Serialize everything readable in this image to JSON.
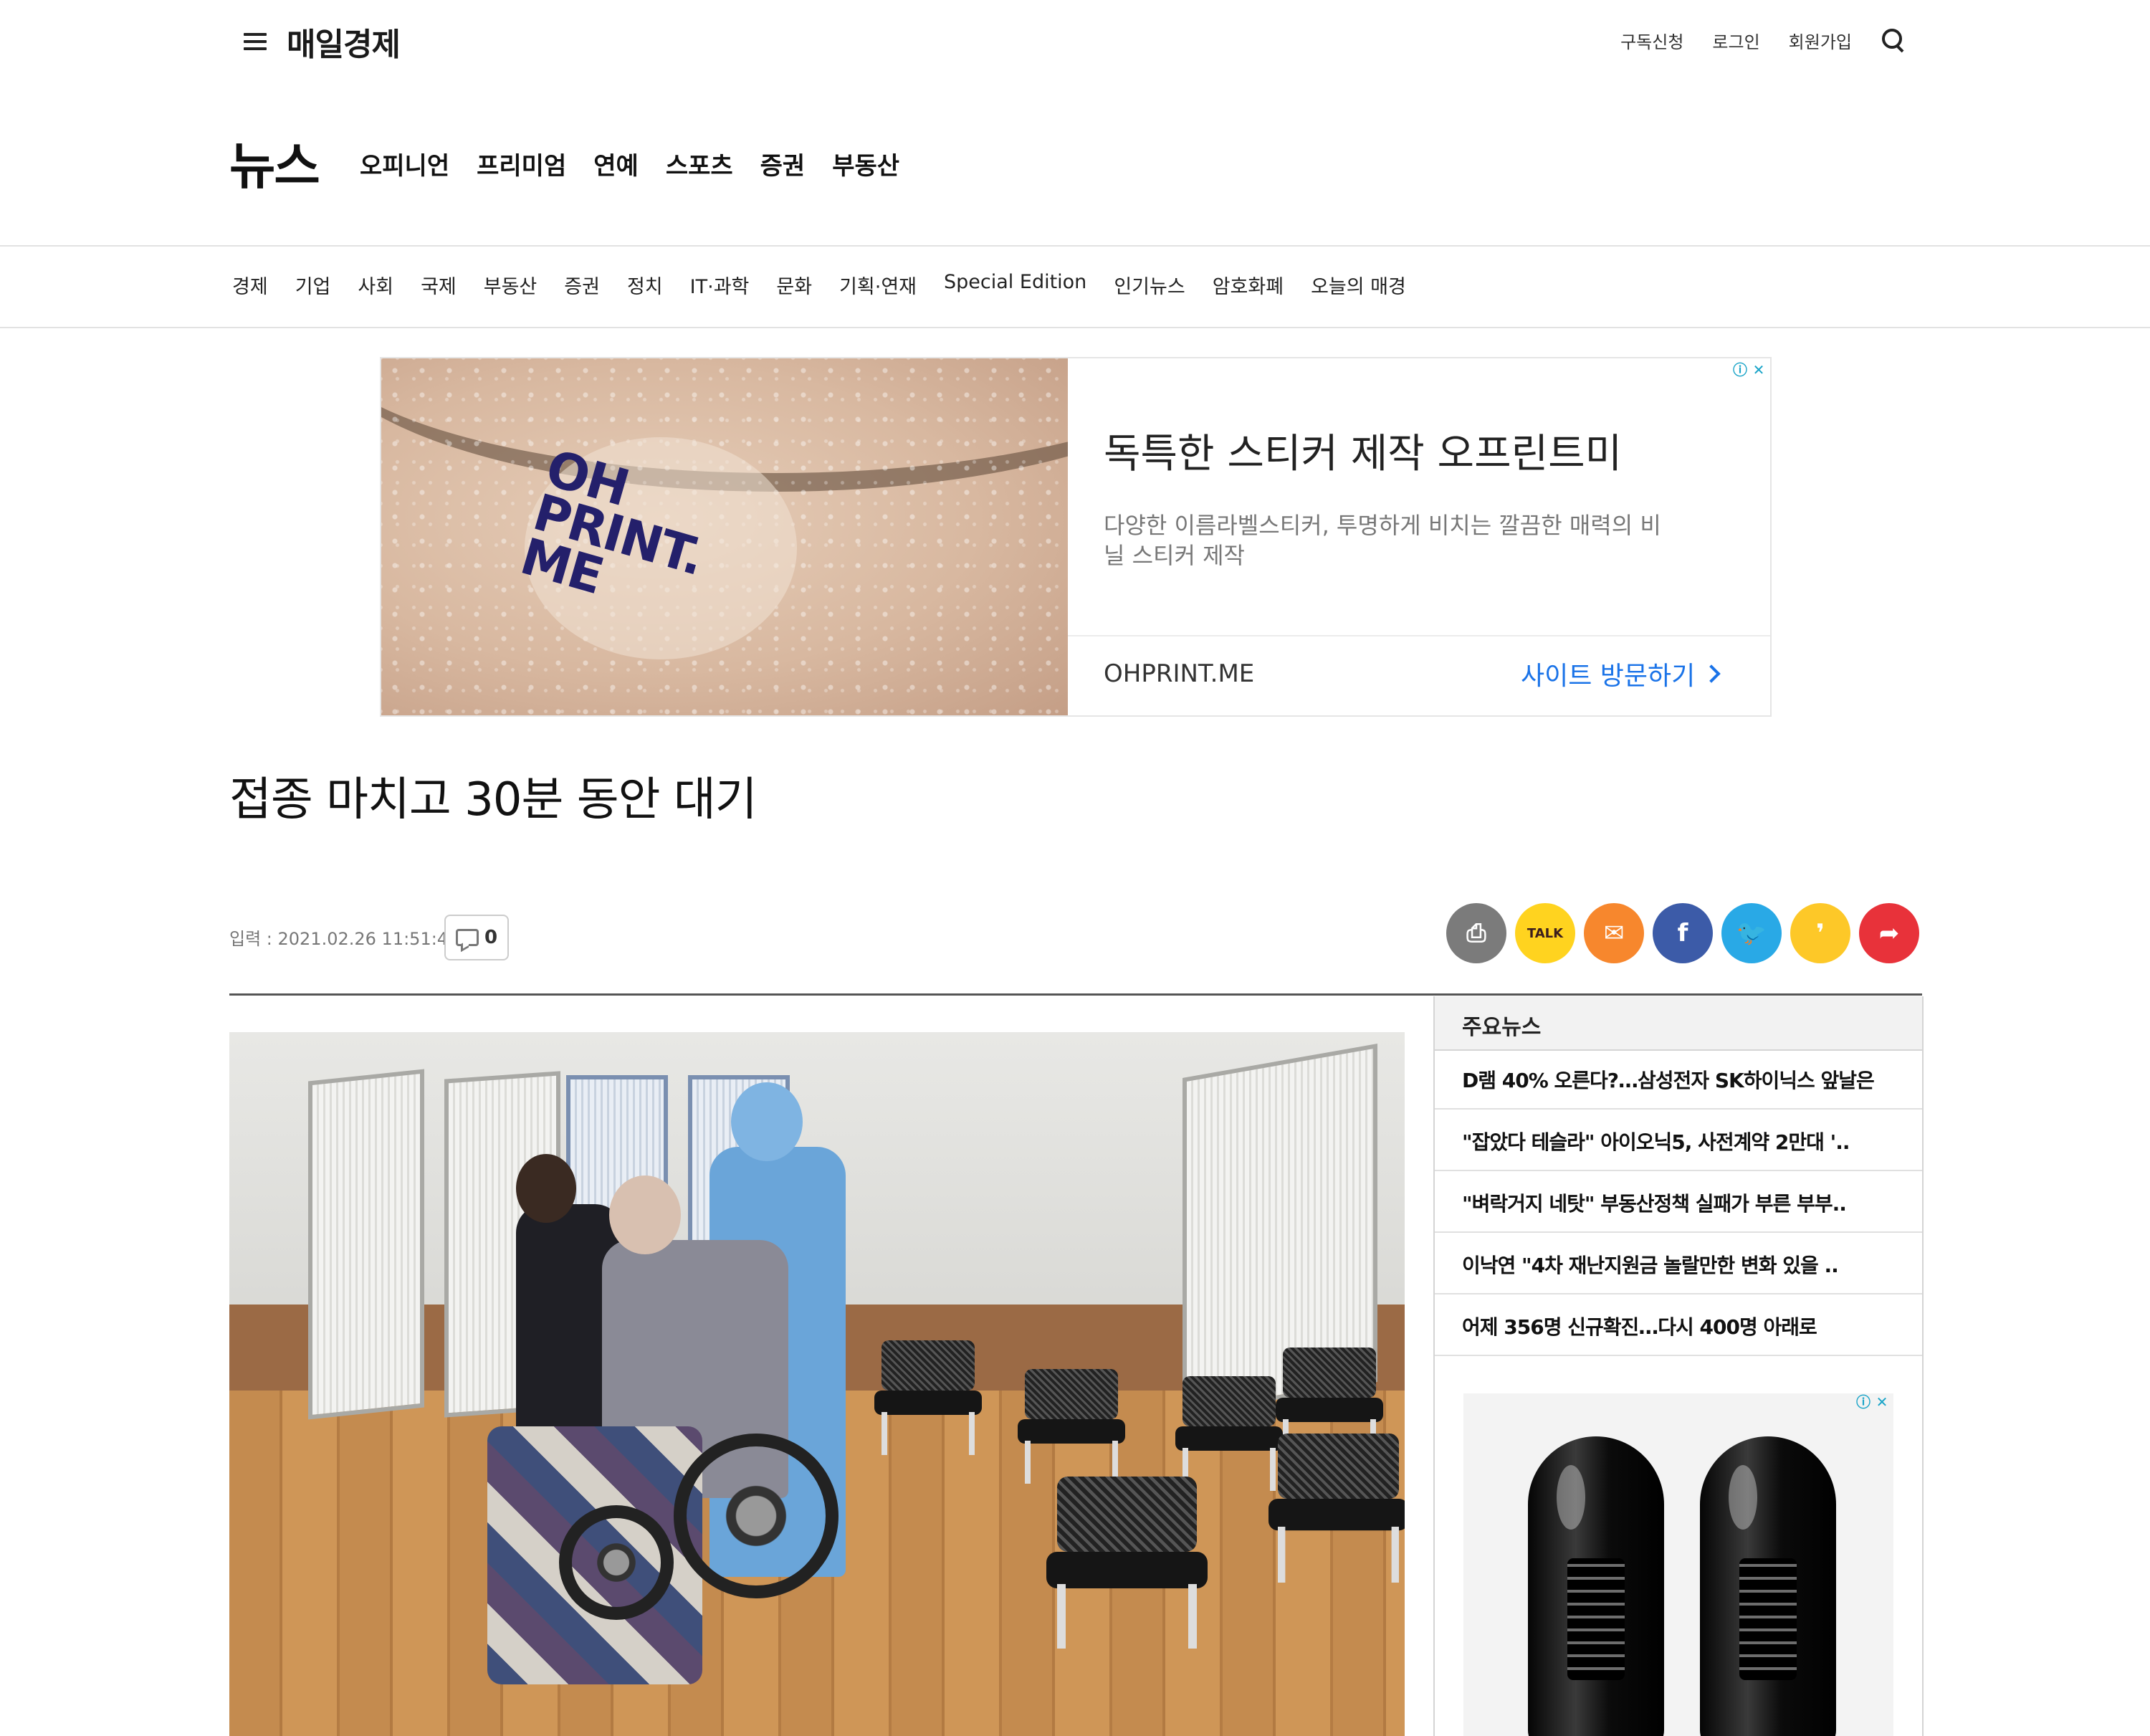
{
  "header": {
    "logo": "매일경제",
    "top_links": [
      "구독신청",
      "로그인",
      "회원가입"
    ]
  },
  "section": {
    "title": "뉴스",
    "nav": [
      "오피니언",
      "프리미엄",
      "연예",
      "스포츠",
      "증권",
      "부동산"
    ]
  },
  "categories": [
    "경제",
    "기업",
    "사회",
    "국제",
    "부동산",
    "증권",
    "정치",
    "IT·과학",
    "문화",
    "기획·연재",
    "Special Edition",
    "인기뉴스",
    "암호화폐",
    "오늘의 매경"
  ],
  "ad": {
    "logo_lines": [
      "OH",
      "PRINT.",
      "ME"
    ],
    "headline": "독특한 스티커 제작 오프린트미",
    "description": "다양한 이름라벨스티커, 투명하게 비치는 깔끔한 매력의 비닐 스티커 제작",
    "domain": "OHPRINT.ME",
    "cta": "사이트 방문하기",
    "info_glyph": "ⓘ",
    "close_glyph": "✕"
  },
  "article": {
    "headline": "접종 마치고 30분 동안 대기",
    "byline": "입력 : 2021.02.26 11:51:46",
    "comment_count": "0"
  },
  "share_buttons": [
    {
      "icon": "print-icon",
      "glyph": "⎙",
      "color": "#7b7b7b"
    },
    {
      "icon": "kakaotalk-icon",
      "glyph": "TALK",
      "color": "#ffd31f"
    },
    {
      "icon": "email-icon",
      "glyph": "✉",
      "color": "#f7872d"
    },
    {
      "icon": "facebook-icon",
      "glyph": "f",
      "color": "#3c5ba8"
    },
    {
      "icon": "twitter-icon",
      "glyph": "🐦",
      "color": "#29a9e6"
    },
    {
      "icon": "kakaostory-icon",
      "glyph": "❜",
      "color": "#fdc828"
    },
    {
      "icon": "share-icon",
      "glyph": "➦",
      "color": "#e8323a"
    }
  ],
  "sidebar": {
    "title": "주요뉴스",
    "items": [
      "D램 40% 오른다?…삼성전자 SK하이닉스 앞날은",
      "\"잡았다 테슬라\" 아이오닉5, 사전계약 2만대 '..",
      "\"벼락거지 네탓\" 부동산정책 실패가 부른 부부..",
      "이낙연 \"4차 재난지원금 놀랄만한 변화 있을 ..",
      "어제 356명 신규확진…다시 400명 아래로"
    ]
  }
}
